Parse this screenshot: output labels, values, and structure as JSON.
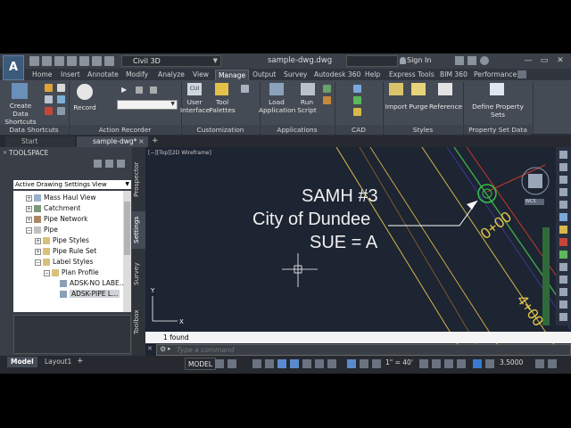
{
  "title_bar": {
    "app_button": "A",
    "workspace": "Civil 3D",
    "document_title": "sample-dwg.dwg",
    "sign_in": "Sign In",
    "window_controls": [
      "—",
      "▭",
      "✕"
    ]
  },
  "ribbon_tabs": [
    "Home",
    "Insert",
    "Annotate",
    "Modify",
    "Analyze",
    "View",
    "Manage",
    "Output",
    "Survey",
    "Autodesk 360",
    "Help",
    "Express Tools",
    "BIM 360",
    "Performance"
  ],
  "active_tab": "Manage",
  "ribbon": {
    "create_data_shortcuts": "Create Data Shortcuts",
    "record": "Record",
    "user_interface": "User Interface",
    "tool_palettes": "Tool Palettes",
    "load_application": "Load Application",
    "run_script": "Run Script",
    "import": "Import",
    "purge": "Purge",
    "reference": "Reference",
    "define_property_sets": "Define Property Sets",
    "panels": {
      "data_shortcuts": "Data Shortcuts",
      "action_recorder": "Action Recorder",
      "customization": "Customization",
      "applications": "Applications",
      "cad_standards": "CAD Standards",
      "styles": "Styles",
      "property_set_data": "Property Set Data"
    }
  },
  "file_tabs": [
    "Start",
    "sample-dwg*"
  ],
  "toolspace": {
    "title": "TOOLSPACE",
    "view_select": "Active Drawing Settings View",
    "tree": [
      {
        "label": "Mass Haul View",
        "indent": 1
      },
      {
        "label": "Catchment",
        "indent": 1
      },
      {
        "label": "Pipe Network",
        "indent": 1
      },
      {
        "label": "Pipe",
        "indent": 1
      },
      {
        "label": "Pipe Styles",
        "indent": 2
      },
      {
        "label": "Pipe Rule Set",
        "indent": 2
      },
      {
        "label": "Label Styles",
        "indent": 2
      },
      {
        "label": "Plan Profile",
        "indent": 3
      },
      {
        "label": "ADSK-NO LABE...",
        "indent": 4
      },
      {
        "label": "ADSK-PIPE L...",
        "indent": 4,
        "selected": true
      }
    ],
    "side_tabs": [
      "Prospector",
      "Settings",
      "Survey",
      "Toolbox"
    ]
  },
  "drawing": {
    "viewport_label": "[−][Top][2D Wireframe]",
    "label_line1": "SAMH #3",
    "label_line2": "City of Dundee",
    "label_line3": "SUE = A",
    "station1": "0+00",
    "station2": "4+00",
    "navcube_label": "WCS",
    "colors": {
      "background": "#1d2432",
      "road_yellow": "#d6b84a",
      "manhole_green": "#33c24a",
      "red_line": "#c23a2a"
    }
  },
  "command_line": {
    "history": "1 found",
    "placeholder": "Type a command"
  },
  "layout_tabs": [
    "Model",
    "Layout1"
  ],
  "status_bar": {
    "model": "MODEL",
    "annotation_scale": "1\" = 40'",
    "lineweight": "3.5000"
  }
}
